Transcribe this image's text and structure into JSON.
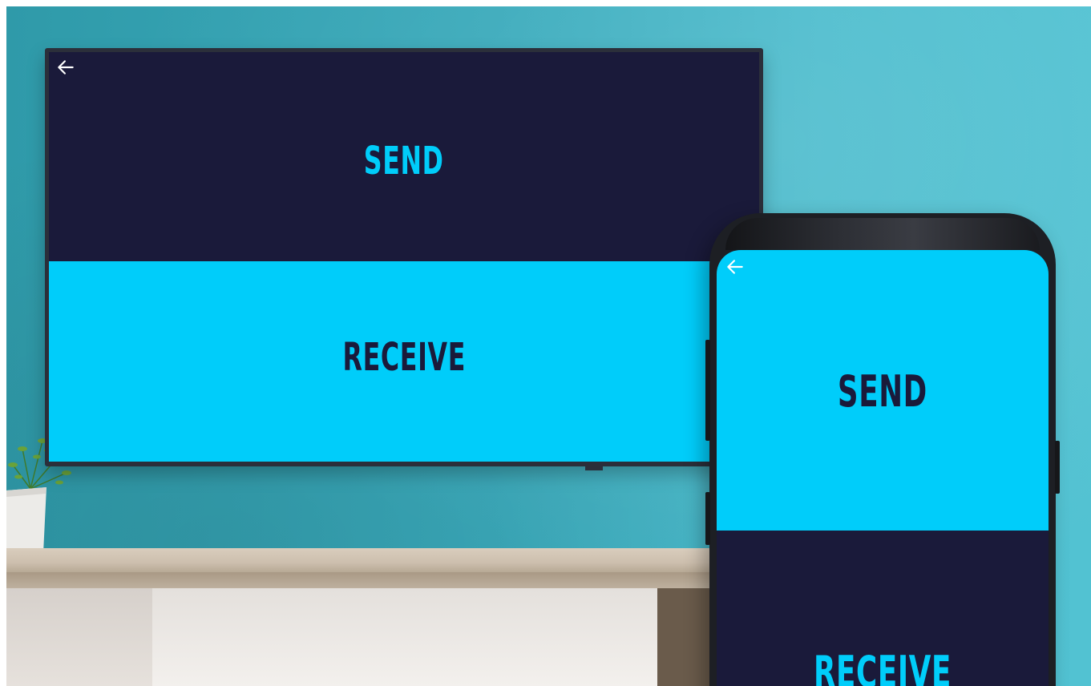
{
  "tv": {
    "send_label": "SEND",
    "receive_label": "RECEIVE",
    "back_icon": "arrow-left-icon"
  },
  "phone": {
    "send_label": "SEND",
    "receive_label": "RECEIVE",
    "back_icon": "arrow-left-icon"
  },
  "colors": {
    "navy": "#1a1a3a",
    "cyan": "#00cdfa",
    "wall": "#3aaabb"
  }
}
